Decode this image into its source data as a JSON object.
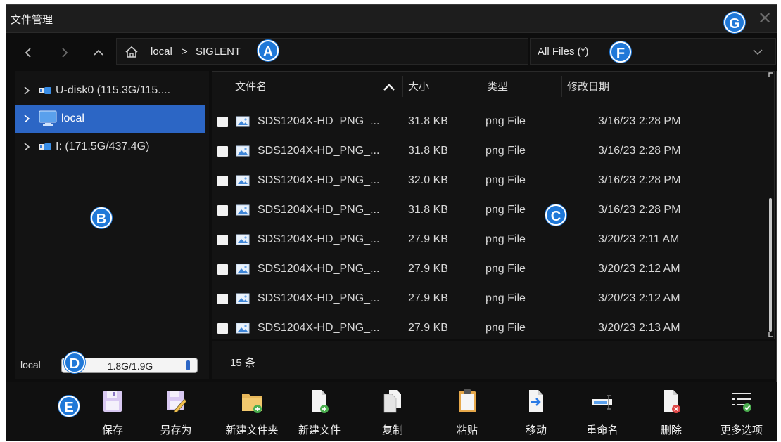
{
  "window": {
    "title": "文件管理",
    "close_glyph": "✕"
  },
  "nav": {
    "back_icon": "chevron-left-icon",
    "forward_icon": "chevron-right-icon",
    "up_icon": "chevron-up-icon",
    "home_icon": "home-icon",
    "path": [
      "local",
      "SIGLENT"
    ],
    "sep": ">"
  },
  "filter": {
    "value": "All Files (*)",
    "icon": "chevron-down-icon"
  },
  "tree": {
    "items": [
      {
        "label": "U-disk0  (115.3G/115....",
        "icon": "usb-drive-icon",
        "selected": false
      },
      {
        "label": "local",
        "icon": "monitor-icon",
        "selected": true
      },
      {
        "label": "I:  (171.5G/437.4G)",
        "icon": "usb-drive-icon",
        "selected": false
      }
    ]
  },
  "filelist": {
    "columns": [
      "文件名",
      "大小",
      "类型",
      "修改日期"
    ],
    "sort_icon": "sort-up-icon",
    "rows": [
      {
        "name": "SDS1204X-HD_PNG_...",
        "size": "31.8 KB",
        "type": "png File",
        "date": "3/16/23 2:28 PM"
      },
      {
        "name": "SDS1204X-HD_PNG_...",
        "size": "31.8 KB",
        "type": "png File",
        "date": "3/16/23 2:28 PM"
      },
      {
        "name": "SDS1204X-HD_PNG_...",
        "size": "32.0 KB",
        "type": "png File",
        "date": "3/16/23 2:28 PM"
      },
      {
        "name": "SDS1204X-HD_PNG_...",
        "size": "31.8 KB",
        "type": "png File",
        "date": "3/16/23 2:28 PM"
      },
      {
        "name": "SDS1204X-HD_PNG_...",
        "size": "27.9 KB",
        "type": "png File",
        "date": "3/20/23 2:11 AM"
      },
      {
        "name": "SDS1204X-HD_PNG_...",
        "size": "27.9 KB",
        "type": "png File",
        "date": "3/20/23 2:12 AM"
      },
      {
        "name": "SDS1204X-HD_PNG_...",
        "size": "27.9 KB",
        "type": "png File",
        "date": "3/20/23 2:12 AM"
      },
      {
        "name": "SDS1204X-HD_PNG_...",
        "size": "27.9 KB",
        "type": "png File",
        "date": "3/20/23 2:13 AM"
      }
    ]
  },
  "storage": {
    "label": "local",
    "value": "1.8G/1.9G",
    "fraction": 0.95
  },
  "status": {
    "count": "15 条"
  },
  "toolbar": {
    "buttons": [
      {
        "label": "保存",
        "icon": "save-icon"
      },
      {
        "label": "另存为",
        "icon": "save-as-icon"
      },
      {
        "label": "新建文件夹",
        "icon": "new-folder-icon"
      },
      {
        "label": "新建文件",
        "icon": "new-file-icon"
      },
      {
        "label": "复制",
        "icon": "copy-icon"
      },
      {
        "label": "粘贴",
        "icon": "paste-icon"
      },
      {
        "label": "移动",
        "icon": "move-icon"
      },
      {
        "label": "重命名",
        "icon": "rename-icon"
      },
      {
        "label": "删除",
        "icon": "delete-icon"
      },
      {
        "label": "更多选项",
        "icon": "more-options-icon"
      }
    ]
  },
  "callouts": [
    "A",
    "B",
    "C",
    "D",
    "E",
    "F",
    "G"
  ],
  "colors": {
    "accent": "#2c66c5",
    "callout": "#1f78d8",
    "background": "#0d0d0d"
  }
}
